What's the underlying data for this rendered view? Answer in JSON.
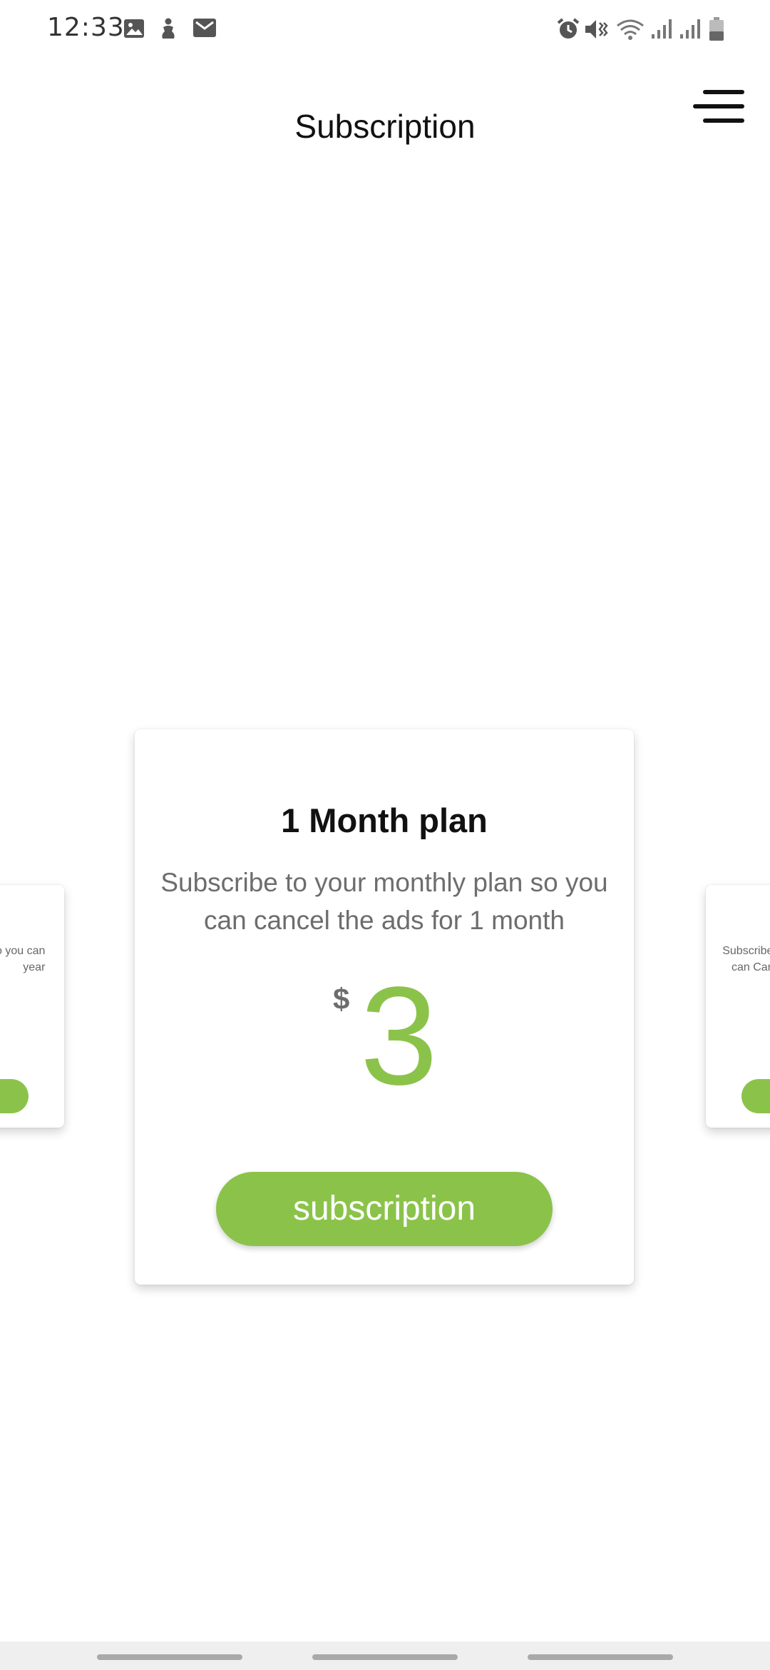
{
  "status_bar": {
    "time": "12:33",
    "left_icons": [
      "image-icon",
      "accessibility-icon",
      "mail-icon"
    ],
    "right_icons": [
      "alarm-icon",
      "vibrate-icon",
      "wifi-icon",
      "signal-icon",
      "signal-icon",
      "battery-icon"
    ]
  },
  "header": {
    "title": "Subscription",
    "menu_icon": "menu-icon"
  },
  "plans": {
    "current": {
      "title": "1 Month plan",
      "description": "Subscribe to your monthly plan so you can cancel the ads for 1 month",
      "currency": "$",
      "price": "3",
      "button_label": "subscription"
    },
    "previous_partial": {
      "description_line1": "o you can",
      "description_line2": "year"
    },
    "next_partial": {
      "description_line1": "Subscribe",
      "description_line2": "can Can"
    }
  },
  "colors": {
    "accent": "#8bc34a",
    "muted_text": "#6d6d6d",
    "title_text": "#111111"
  },
  "nav_bar": {
    "handles": [
      "recents-handle",
      "home-handle",
      "back-handle"
    ]
  }
}
